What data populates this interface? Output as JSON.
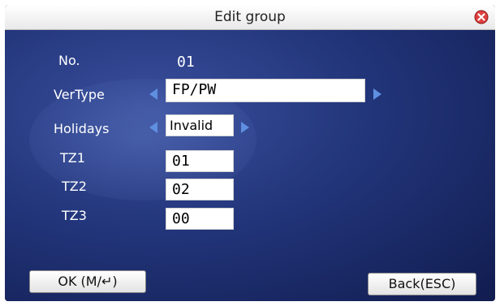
{
  "window": {
    "title": "Edit group"
  },
  "form": {
    "no_label": "No.",
    "no_value": "01",
    "vertype_label": "VerType",
    "vertype_value": "FP/PW",
    "holidays_label": "Holidays",
    "holidays_value": "Invalid",
    "tz1_label": "TZ1",
    "tz1_value": "01",
    "tz2_label": "TZ2",
    "tz2_value": "02",
    "tz3_label": "TZ3",
    "tz3_value": "00"
  },
  "buttons": {
    "ok_label": "OK (M/↵)",
    "back_label": "Back(ESC)"
  },
  "colors": {
    "screen_bg": "#22357a",
    "arrow": "#5f8fe0",
    "close_icon": "#e04040"
  }
}
